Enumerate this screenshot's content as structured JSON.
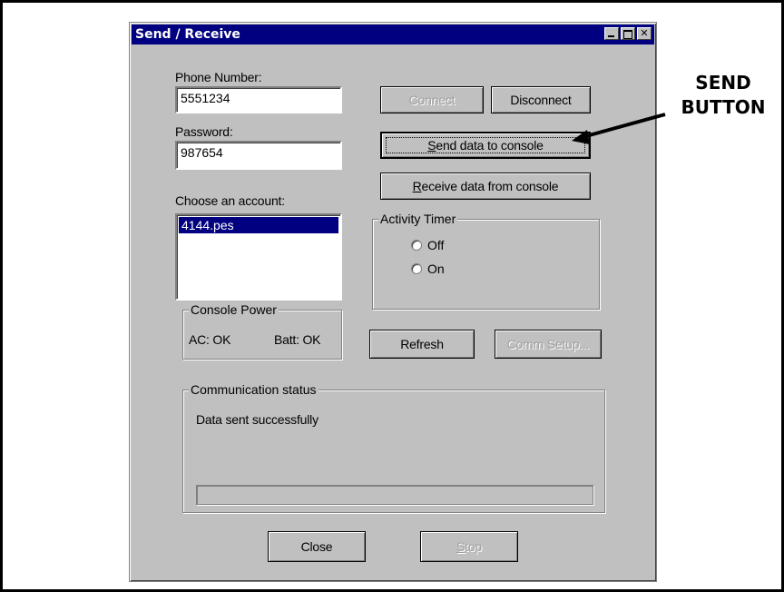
{
  "window": {
    "title": "Send / Receive"
  },
  "fields": {
    "phone_label": "Phone Number:",
    "phone_value": "5551234",
    "password_label": "Password:",
    "password_value": "987654",
    "account_label": "Choose an account:",
    "accounts": [
      "4144.pes"
    ]
  },
  "buttons": {
    "connect": "Connect",
    "disconnect": "Disconnect",
    "send_prefix": "S",
    "send_rest": "end data to console",
    "receive_prefix": "R",
    "receive_rest": "eceive data from console",
    "refresh": "Refresh",
    "comm_setup": "Comm Setup...",
    "close": "Close",
    "stop_prefix": "S",
    "stop_rest": "top"
  },
  "activity_timer": {
    "title": "Activity Timer",
    "options": [
      "Off",
      "On"
    ]
  },
  "console_power": {
    "title": "Console Power",
    "ac": "AC: OK",
    "batt": "Batt: OK"
  },
  "communication": {
    "title": "Communication status",
    "message": "Data sent successfully"
  },
  "callout": {
    "line1": "SEND",
    "line2": "BUTTON"
  },
  "colors": {
    "titlebar": "#000080",
    "face": "#c0c0c0",
    "selection": "#000080"
  }
}
